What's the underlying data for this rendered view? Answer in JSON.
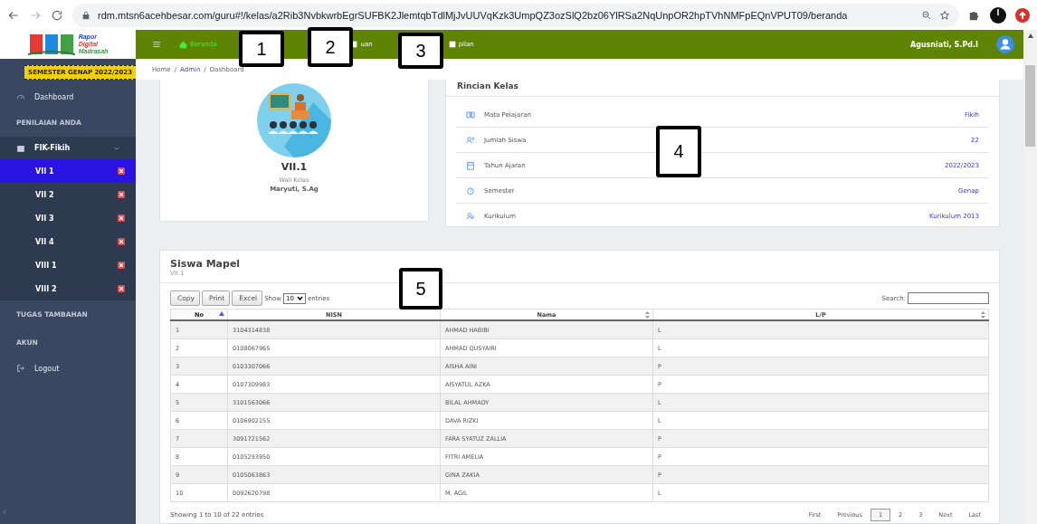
{
  "browser": {
    "url": "rdm.mtsn6acehbesar.com/guru#!/kelas/a2Rib3NvbkwrbEgrSUFBK2JlemtqbTdlMjJvUUVqKzk3UmpQZ3ozSlQ2bz06YlRSa2NqUnpOR2hpTVhNMFpEQnVPUT09/beranda"
  },
  "logo": {
    "line_1": "Rapor",
    "line_2": "Digital",
    "line_3": "Madrasah"
  },
  "semester_badge": "SEMESTER GENAP 2022/2023",
  "sidebar": [
    {
      "kind": "link",
      "label": "Dashboard"
    },
    {
      "kind": "section",
      "label": "PENILAIAN ANDA"
    },
    {
      "kind": "group",
      "label": "FIK-Fikih",
      "expanded": true,
      "children": [
        {
          "label": "VII 1",
          "selected": true
        },
        {
          "label": "VII 2",
          "selected": false
        },
        {
          "label": "VII 3",
          "selected": false
        },
        {
          "label": "VII 4",
          "selected": false
        },
        {
          "label": "VIII 1",
          "selected": false
        },
        {
          "label": "VIII 2",
          "selected": false
        }
      ]
    },
    {
      "kind": "section",
      "label": "TUGAS TAMBAHAN"
    },
    {
      "kind": "section",
      "label": "AKUN"
    },
    {
      "kind": "logout",
      "label": "Logout"
    }
  ],
  "header": {
    "nav": [
      {
        "label": "Beranda",
        "selected": true
      },
      {
        "label": "uan",
        "selected": false
      },
      {
        "label": "pilan",
        "selected": false
      }
    ],
    "user": "Agusniati, S.Pd.I"
  },
  "breadcrumb": [
    {
      "label": "Home",
      "kind": "text"
    },
    {
      "label": "/",
      "kind": "separator"
    },
    {
      "label": "Admin",
      "kind": "link"
    },
    {
      "label": "/",
      "kind": "separator"
    },
    {
      "label": "Dashboard",
      "kind": "text"
    }
  ],
  "profile": {
    "class_name": "VII.1",
    "caption": "Wali Kelas",
    "teacher": "Maryuti, S.Ag"
  },
  "details": {
    "title": "Rincian Kelas",
    "rows": [
      {
        "label": "Mata Pelajaran",
        "value": "Fikih"
      },
      {
        "label": "Jumlah Siswa",
        "value": "22"
      },
      {
        "label": "Tahun Ajaran",
        "value": "2022/2023"
      },
      {
        "label": "Semester",
        "value": "Genap"
      },
      {
        "label": "Kurikulum",
        "value": "Kurikulum 2013"
      }
    ]
  },
  "students": {
    "title": "Siswa Mapel",
    "subtitle": "VII.1",
    "buttons": [
      "Copy",
      "Print",
      "Excel"
    ],
    "show_label": "Show",
    "page_length": "10",
    "entries_label": "entries",
    "search_label": "Search:",
    "columns": [
      {
        "label": "No",
        "sortable": true,
        "sorted": true
      },
      {
        "label": "NISN",
        "sortable": false,
        "sorted": false
      },
      {
        "label": "Nama",
        "sortable": true,
        "sorted": false
      },
      {
        "label": "L/P",
        "sortable": true,
        "sorted": false
      }
    ],
    "rows": [
      [
        "1",
        "3104314838",
        "AHMAD HABIBI",
        "L"
      ],
      [
        "2",
        "0108067965",
        "AHMAD QUSYAIRI",
        "L"
      ],
      [
        "3",
        "0103307066",
        "AISHA AINI",
        "P"
      ],
      [
        "4",
        "0107309983",
        "AISYATUL AZKA",
        "P"
      ],
      [
        "5",
        "3101563066",
        "BILAL AHMADY",
        "L"
      ],
      [
        "6",
        "0106902155",
        "DAVA RIZKI",
        "L"
      ],
      [
        "7",
        "3091721562",
        "FARA SYATUZ ZALLIA",
        "P"
      ],
      [
        "8",
        "0105293950",
        "FITRI AMELIA",
        "P"
      ],
      [
        "9",
        "0105063863",
        "GINA ZAKIA",
        "P"
      ],
      [
        "10",
        "0092620798",
        "M. AGIL",
        "L"
      ]
    ],
    "info": "Showing 1 to 10 of 22 entries",
    "pagination": [
      {
        "label": "First",
        "selected": false
      },
      {
        "label": "Previous",
        "selected": false
      },
      {
        "label": "1",
        "selected": true
      },
      {
        "label": "2",
        "selected": false
      },
      {
        "label": "3",
        "selected": false
      },
      {
        "label": "Next",
        "selected": false
      },
      {
        "label": "Last",
        "selected": false
      }
    ]
  },
  "annotations": [
    "1",
    "2",
    "3",
    "4",
    "5"
  ]
}
